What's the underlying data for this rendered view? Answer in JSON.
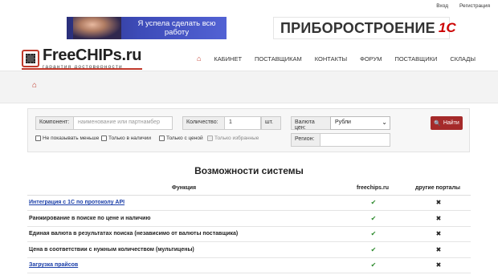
{
  "top_links": {
    "login": "Вход",
    "register": "Регистрация"
  },
  "banner_left": {
    "text": "Я успела сделать всю работу"
  },
  "banner_right": {
    "brand": "ПРИБОРОСТРОЕНИЕ",
    "suffix": "1С"
  },
  "logo": {
    "title": "FreeCHIPs.ru",
    "subtitle": "гарантия достоверности"
  },
  "nav": {
    "home_icon": "home-icon",
    "items": [
      "КАБИНЕТ",
      "ПОСТАВЩИКАМ",
      "КОНТАКТЫ",
      "ФОРУМ",
      "ПОСТАВЩИКИ",
      "СКЛАДЫ"
    ]
  },
  "search": {
    "component_label": "Компонент:",
    "component_placeholder": "наименование или партнамбер",
    "qty_label": "Количество:",
    "qty_value": "1",
    "qty_unit": "шт.",
    "currency_label": "Валюта цен:",
    "currency_value": "Рубли",
    "region_label": "Регион:",
    "region_value": "",
    "find_label": "Найти",
    "checkboxes": [
      "Не показывать меньше",
      "Только в наличии",
      "Только с ценой",
      "Только избранные"
    ]
  },
  "features": {
    "title": "Возможности системы",
    "headers": {
      "function": "Функция",
      "freechips": "freechips.ru",
      "others": "другие  порталы"
    },
    "rows": [
      {
        "name": "Интеграция с 1С по протоколу API",
        "link": true,
        "freechips": "✔",
        "others": "✖"
      },
      {
        "name": "Ранжирование в поиске по цене и наличию",
        "link": false,
        "freechips": "✔",
        "others": "✖"
      },
      {
        "name": "Единая валюта в результатах поиска (независимо от валюты поставщика)",
        "link": false,
        "freechips": "✔",
        "others": "✖"
      },
      {
        "name": "Цена в соответствии с нужным количеством (мультицены)",
        "link": false,
        "freechips": "✔",
        "others": "✖"
      },
      {
        "name": "Загрузка прайсов",
        "link": true,
        "freechips": "✔",
        "others": "✖"
      }
    ]
  },
  "colors": {
    "accent": "#c0392b",
    "button": "#a52a2a",
    "link": "#1a3ea8",
    "yes": "#2e8b2e"
  }
}
